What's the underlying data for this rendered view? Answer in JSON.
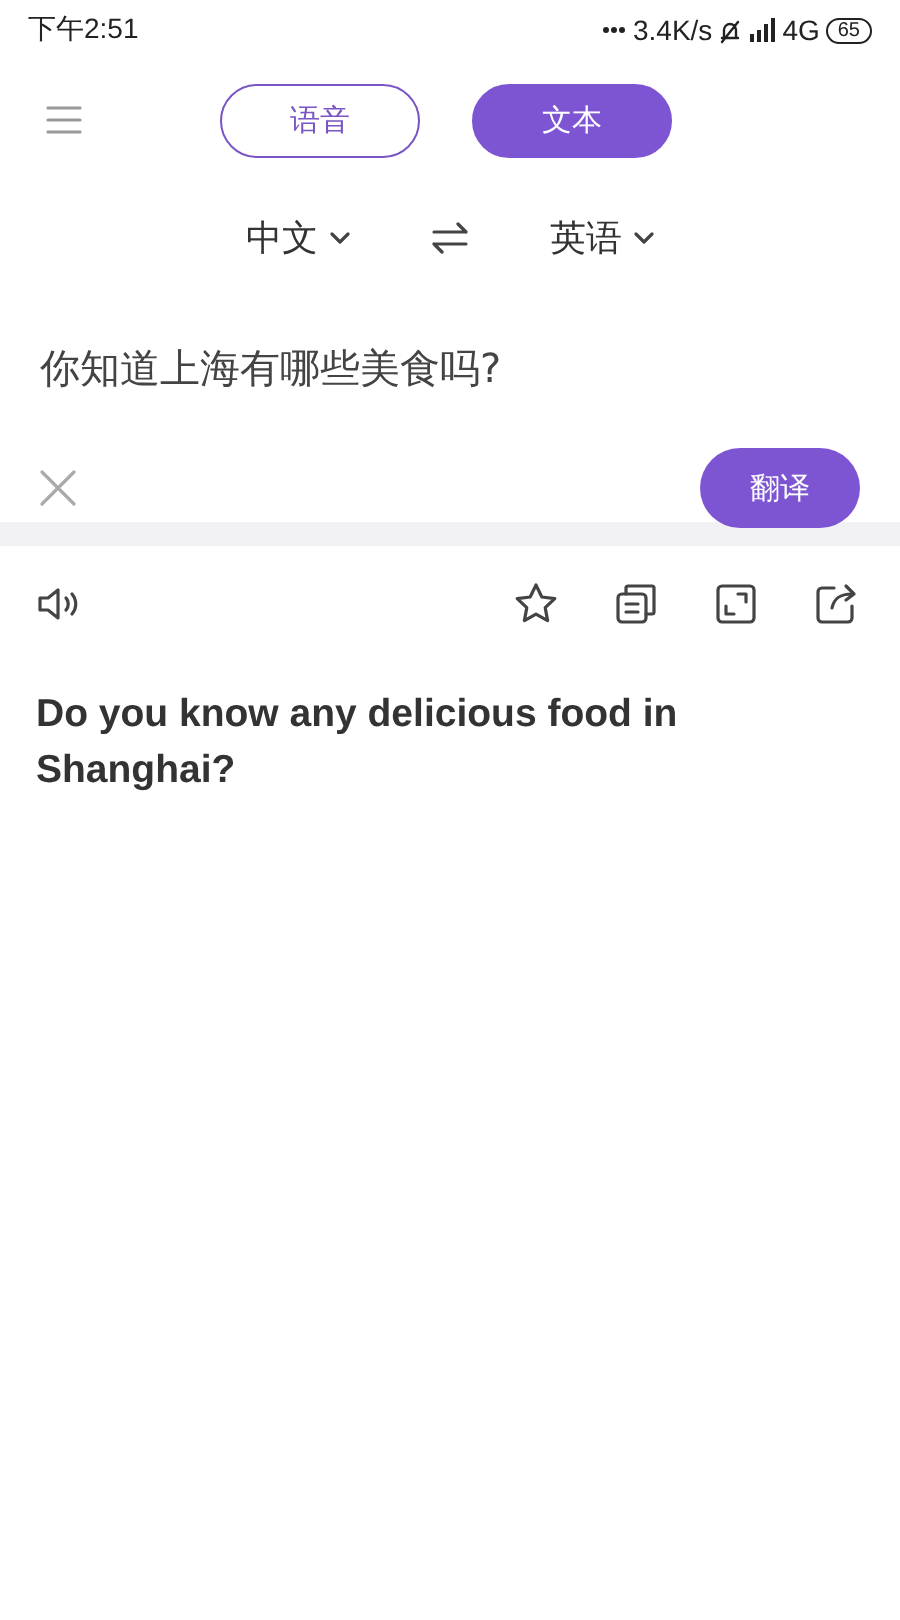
{
  "status_bar": {
    "time": "下午2:51",
    "net_speed": "3.4K/s",
    "network": "4G",
    "battery": "65"
  },
  "tabs": [
    {
      "label": "语音",
      "selected": false
    },
    {
      "label": "文本",
      "selected": true
    }
  ],
  "languages": {
    "source": "中文",
    "target": "英语"
  },
  "input": {
    "value": "你知道上海有哪些美食吗?"
  },
  "translate_button": "翻译",
  "result": {
    "text": "Do you know any delicious food in Shanghai?"
  }
}
